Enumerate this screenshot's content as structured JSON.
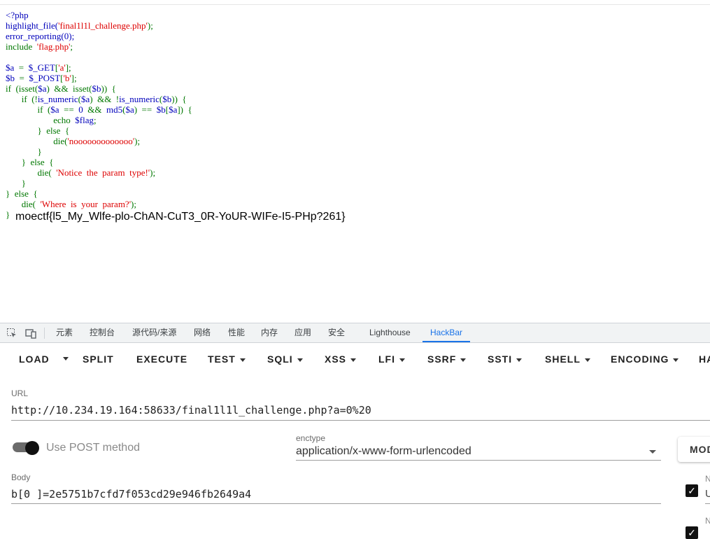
{
  "source_code": {
    "lines": [
      [
        {
          "t": "<?php",
          "c": "v"
        }
      ],
      [
        {
          "t": "highlight_file(",
          "c": "v"
        },
        {
          "t": "'final1l1l_challenge.php'",
          "c": "s"
        },
        {
          "t": ");",
          "c": "k"
        }
      ],
      [
        {
          "t": "error_reporting(0);",
          "c": "v"
        }
      ],
      [
        {
          "t": "include  ",
          "c": "k"
        },
        {
          "t": "'flag.php'",
          "c": "s"
        },
        {
          "t": ";",
          "c": "k"
        }
      ],
      [
        {
          "t": "",
          "c": "k"
        }
      ],
      [
        {
          "t": "$a",
          "c": "v"
        },
        {
          "t": "  =  ",
          "c": "k"
        },
        {
          "t": "$_GET",
          "c": "v"
        },
        {
          "t": "[",
          "c": "k"
        },
        {
          "t": "'a'",
          "c": "s"
        },
        {
          "t": "];",
          "c": "k"
        }
      ],
      [
        {
          "t": "$b",
          "c": "v"
        },
        {
          "t": "  =  ",
          "c": "k"
        },
        {
          "t": "$_POST",
          "c": "v"
        },
        {
          "t": "[",
          "c": "k"
        },
        {
          "t": "'b'",
          "c": "s"
        },
        {
          "t": "];",
          "c": "k"
        }
      ],
      [
        {
          "t": "if  (isset(",
          "c": "k"
        },
        {
          "t": "$a",
          "c": "v"
        },
        {
          "t": ")  &&  isset(",
          "c": "k"
        },
        {
          "t": "$b",
          "c": "v"
        },
        {
          "t": "))  {",
          "c": "k"
        }
      ],
      [
        {
          "t": "       if  (!",
          "c": "k"
        },
        {
          "t": "is_numeric",
          "c": "v"
        },
        {
          "t": "(",
          "c": "k"
        },
        {
          "t": "$a",
          "c": "v"
        },
        {
          "t": ")  &&  !",
          "c": "k"
        },
        {
          "t": "is_numeric",
          "c": "v"
        },
        {
          "t": "(",
          "c": "k"
        },
        {
          "t": "$b",
          "c": "v"
        },
        {
          "t": "))  {",
          "c": "k"
        }
      ],
      [
        {
          "t": "              if  (",
          "c": "k"
        },
        {
          "t": "$a",
          "c": "v"
        },
        {
          "t": "  ==  ",
          "c": "k"
        },
        {
          "t": "0",
          "c": "v"
        },
        {
          "t": "  &&  ",
          "c": "k"
        },
        {
          "t": "md5",
          "c": "v"
        },
        {
          "t": "(",
          "c": "k"
        },
        {
          "t": "$a",
          "c": "v"
        },
        {
          "t": ")  ==  ",
          "c": "k"
        },
        {
          "t": "$b",
          "c": "v"
        },
        {
          "t": "[",
          "c": "k"
        },
        {
          "t": "$a",
          "c": "v"
        },
        {
          "t": "])  {",
          "c": "k"
        }
      ],
      [
        {
          "t": "                     echo  ",
          "c": "k"
        },
        {
          "t": "$flag",
          "c": "v"
        },
        {
          "t": ";",
          "c": "k"
        }
      ],
      [
        {
          "t": "              }  else  {",
          "c": "k"
        }
      ],
      [
        {
          "t": "                     die(",
          "c": "k"
        },
        {
          "t": "'nooooooooooooo'",
          "c": "s"
        },
        {
          "t": ");",
          "c": "k"
        }
      ],
      [
        {
          "t": "              }",
          "c": "k"
        }
      ],
      [
        {
          "t": "       }  else  {",
          "c": "k"
        }
      ],
      [
        {
          "t": "              die(  ",
          "c": "k"
        },
        {
          "t": "'Notice  the  param  type!'",
          "c": "s"
        },
        {
          "t": ");",
          "c": "k"
        }
      ],
      [
        {
          "t": "       }",
          "c": "k"
        }
      ],
      [
        {
          "t": "}  else  {",
          "c": "k"
        }
      ],
      [
        {
          "t": "       die(  ",
          "c": "k"
        },
        {
          "t": "'Where  is  your  param?'",
          "c": "s"
        },
        {
          "t": ");",
          "c": "k"
        }
      ],
      [
        {
          "t": "}",
          "c": "k"
        }
      ]
    ]
  },
  "flag_output": "moectf{l5_My_Wlfe-plo-ChAN-CuT3_0R-YoUR-WIFe-I5-PHp?261}",
  "devtools_tabs": [
    "元素",
    "控制台",
    "源代码/来源",
    "网络",
    "性能",
    "内存",
    "应用",
    "安全",
    "Lighthouse",
    "HackBar"
  ],
  "devtools_active": "HackBar",
  "hackbar": {
    "toolbar": [
      "LOAD",
      "SPLIT",
      "EXECUTE",
      "TEST",
      "SQLI",
      "XSS",
      "LFI",
      "SSRF",
      "SSTI",
      "SHELL",
      "ENCODING",
      "HA"
    ],
    "url_label": "URL",
    "url_value": "http://10.234.19.164:58633/final1l1l_challenge.php?a=0%20",
    "post_toggle_label": "Use POST method",
    "enctype_label": "enctype",
    "enctype_value": "application/x-www-form-urlencoded",
    "modify_button": "MOD",
    "body_label": "Body",
    "body_value": "b[0 ]=2e5751b7cfd7f053cd29e946fb2649a4",
    "side_label_1": "N",
    "side_label_2": "U",
    "side_label_3": "N"
  },
  "colors": {
    "keyword": "#007700",
    "variable": "#0000BB",
    "string": "#DD0000",
    "accent": "#1a73e8"
  }
}
